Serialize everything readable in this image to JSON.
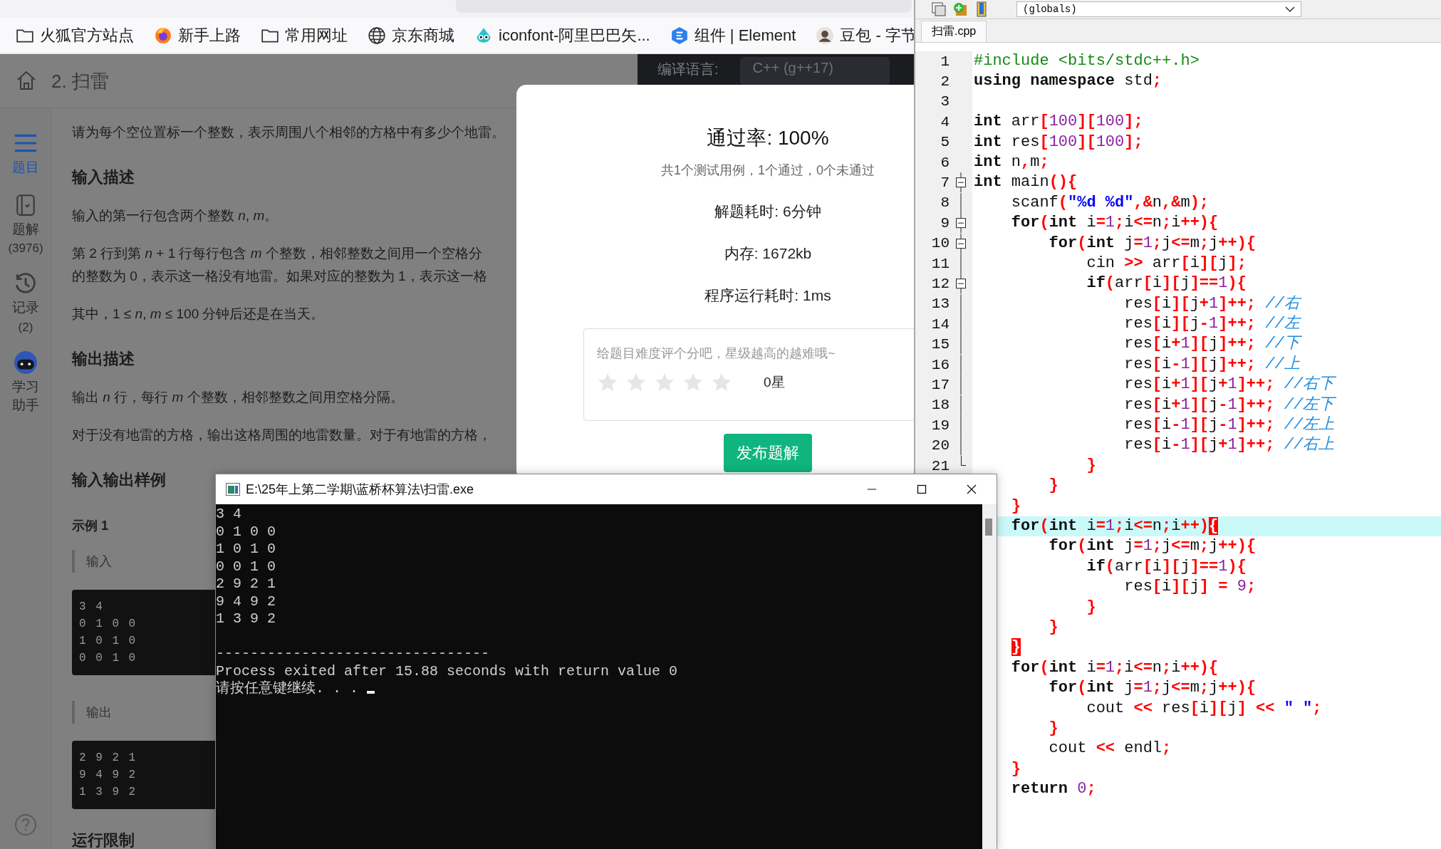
{
  "browser": {
    "bookmarks": [
      {
        "kind": "folder",
        "label": "火狐官方站点"
      },
      {
        "kind": "firefox",
        "label": "新手上路"
      },
      {
        "kind": "folder",
        "label": "常用网址"
      },
      {
        "kind": "globe",
        "label": "京东商城"
      },
      {
        "kind": "mascot",
        "label": "iconfont-阿里巴巴矢..."
      },
      {
        "kind": "hexagon",
        "label": "组件 | Element"
      },
      {
        "kind": "avatar",
        "label": "豆包 - 字节"
      }
    ],
    "page": {
      "title": "2. 扫雷",
      "compile_label": "编译语言:",
      "compile_value": "C++ (g++17)",
      "sidebar": [
        {
          "kind": "list",
          "label": "题目",
          "selected": true
        },
        {
          "kind": "book",
          "label": "题解",
          "count": "(3976)",
          "selected": false
        },
        {
          "kind": "history",
          "label": "记录",
          "count": "(2)",
          "selected": false
        },
        {
          "kind": "robot",
          "label": "学习助手",
          "selected": false
        }
      ],
      "blocks": [
        {
          "kind": "p",
          "lines": [
            "请为每个空位置标一个整数，表示周围八个相邻的方格中有多少个地雷。"
          ]
        },
        {
          "kind": "h",
          "text": "输入描述"
        },
        {
          "kind": "p",
          "lines": [
            "输入的第一行包含两个整数 *n*, *m*。"
          ]
        },
        {
          "kind": "p",
          "lines": [
            "第 2 行到第 *n* + 1 行每行包含 *m* 个整数，相邻整数之间用一个空格分",
            "的整数为 0，表示这一格没有地雷。如果对应的整数为 1，表示这一格"
          ]
        },
        {
          "kind": "p",
          "lines": [
            "其中，1 ≤ *n*, *m* ≤ 100 分钟后还是在当天。"
          ]
        },
        {
          "kind": "h",
          "text": "输出描述"
        },
        {
          "kind": "p",
          "lines": [
            "输出 *n* 行，每行 *m* 个整数，相邻整数之间用空格分隔。"
          ]
        },
        {
          "kind": "p",
          "lines": [
            "对于没有地雷的方格，输出这格周围的地雷数量。对于有地雷的方格，"
          ]
        },
        {
          "kind": "h",
          "text": "输入输出样例"
        },
        {
          "kind": "h3",
          "text": "示例 1"
        },
        {
          "kind": "label",
          "text": "输入"
        },
        {
          "kind": "sample",
          "lines": [
            "3 4",
            "0 1 0 0",
            "1 0 1 0",
            "0 0 1 0"
          ]
        },
        {
          "kind": "label",
          "text": "输出"
        },
        {
          "kind": "sample",
          "lines": [
            "2 9 2 1",
            "9 4 9 2",
            "1 3 9 2"
          ]
        },
        {
          "kind": "h",
          "text": "运行限制"
        }
      ]
    },
    "modal": {
      "pass_rate": "通过率: 100%",
      "summary": "共1个测试用例，1个通过，0个未通过",
      "stats": [
        "解题耗时: 6分钟",
        "内存: 1672kb",
        "程序运行耗时: 1ms"
      ],
      "rating": {
        "hint": "给题目难度评个分吧，星级越高的越难哦~",
        "stars": 0,
        "reading": "0星"
      },
      "button": "发布题解"
    }
  },
  "console": {
    "title": "E:\\25年上第二学期\\蓝桥杯算法\\扫雷.exe",
    "cursor": true,
    "lines": [
      {
        "kind": "out",
        "text": "3 4"
      },
      {
        "kind": "out",
        "text": "0 1 0 0"
      },
      {
        "kind": "out",
        "text": "1 0 1 0"
      },
      {
        "kind": "out",
        "text": "0 0 1 0"
      },
      {
        "kind": "out",
        "text": "2 9 2 1"
      },
      {
        "kind": "out",
        "text": "9 4 9 2"
      },
      {
        "kind": "out",
        "text": "1 3 9 2"
      },
      {
        "kind": "rule",
        "text": "--------------------------------"
      },
      {
        "kind": "out",
        "text": "Process exited after 15.88 seconds with return value 0"
      },
      {
        "kind": "prompt",
        "text": "请按任意键继续. . . "
      }
    ]
  },
  "editor": {
    "scope": "(globals)",
    "tab": "扫雷.cpp",
    "lines": [
      {
        "num": "1",
        "highlighted": false,
        "tokens": [
          {
            "kind": "pre",
            "text": "#include <bits/stdc++.h>"
          }
        ]
      },
      {
        "num": "2",
        "highlighted": false,
        "tokens": [
          {
            "kind": "kw",
            "text": "using namespace"
          },
          {
            "kind": "id",
            "text": " std"
          },
          {
            "kind": "punct",
            "text": ";"
          }
        ]
      },
      {
        "num": "3",
        "highlighted": false
      },
      {
        "num": "4",
        "highlighted": false,
        "tokens": [
          {
            "kind": "kw",
            "text": "int"
          },
          {
            "kind": "id",
            "text": " arr"
          },
          {
            "kind": "punct",
            "text": "["
          },
          {
            "kind": "num",
            "text": "100"
          },
          {
            "kind": "punct",
            "text": "]["
          },
          {
            "kind": "num",
            "text": "100"
          },
          {
            "kind": "punct",
            "text": "];"
          }
        ]
      },
      {
        "num": "5",
        "highlighted": false,
        "tokens": [
          {
            "kind": "kw",
            "text": "int"
          },
          {
            "kind": "id",
            "text": " res"
          },
          {
            "kind": "punct",
            "text": "["
          },
          {
            "kind": "num",
            "text": "100"
          },
          {
            "kind": "punct",
            "text": "]["
          },
          {
            "kind": "num",
            "text": "100"
          },
          {
            "kind": "punct",
            "text": "];"
          }
        ]
      },
      {
        "num": "6",
        "highlighted": false,
        "tokens": [
          {
            "kind": "kw",
            "text": "int"
          },
          {
            "kind": "id",
            "text": " n"
          },
          {
            "kind": "punct",
            "text": ","
          },
          {
            "kind": "id",
            "text": "m"
          },
          {
            "kind": "punct",
            "text": ";"
          }
        ]
      },
      {
        "num": "7",
        "fold": {
          "kind": "box"
        },
        "highlighted": false,
        "tokens": [
          {
            "kind": "kw",
            "text": "int"
          },
          {
            "kind": "id",
            "text": " main"
          },
          {
            "kind": "punct",
            "text": "(){"
          }
        ]
      },
      {
        "num": "8",
        "fold": {
          "kind": "line"
        },
        "highlighted": false,
        "tokens": [
          {
            "kind": "id",
            "text": "    scanf"
          },
          {
            "kind": "punct",
            "text": "("
          },
          {
            "kind": "str",
            "text": "\"%d %d\""
          },
          {
            "kind": "punct",
            "text": ",&"
          },
          {
            "kind": "id",
            "text": "n"
          },
          {
            "kind": "punct",
            "text": ",&"
          },
          {
            "kind": "id",
            "text": "m"
          },
          {
            "kind": "punct",
            "text": ");"
          }
        ]
      },
      {
        "num": "9",
        "fold": {
          "kind": "box"
        },
        "highlighted": false,
        "tokens": [
          {
            "kind": "kw",
            "text": "    for"
          },
          {
            "kind": "punct",
            "text": "("
          },
          {
            "kind": "kw",
            "text": "int"
          },
          {
            "kind": "id",
            "text": " i"
          },
          {
            "kind": "punct",
            "text": "="
          },
          {
            "kind": "num",
            "text": "1"
          },
          {
            "kind": "punct",
            "text": ";"
          },
          {
            "kind": "id",
            "text": "i"
          },
          {
            "kind": "punct",
            "text": "<="
          },
          {
            "kind": "id",
            "text": "n"
          },
          {
            "kind": "punct",
            "text": ";"
          },
          {
            "kind": "id",
            "text": "i"
          },
          {
            "kind": "punct",
            "text": "++){"
          }
        ]
      },
      {
        "num": "10",
        "fold": {
          "kind": "box"
        },
        "highlighted": false,
        "tokens": [
          {
            "kind": "kw",
            "text": "        for"
          },
          {
            "kind": "punct",
            "text": "("
          },
          {
            "kind": "kw",
            "text": "int"
          },
          {
            "kind": "id",
            "text": " j"
          },
          {
            "kind": "punct",
            "text": "="
          },
          {
            "kind": "num",
            "text": "1"
          },
          {
            "kind": "punct",
            "text": ";"
          },
          {
            "kind": "id",
            "text": "j"
          },
          {
            "kind": "punct",
            "text": "<="
          },
          {
            "kind": "id",
            "text": "m"
          },
          {
            "kind": "punct",
            "text": ";"
          },
          {
            "kind": "id",
            "text": "j"
          },
          {
            "kind": "punct",
            "text": "++){"
          }
        ]
      },
      {
        "num": "11",
        "fold": {
          "kind": "line"
        },
        "highlighted": false,
        "tokens": [
          {
            "kind": "id",
            "text": "            cin "
          },
          {
            "kind": "punct",
            "text": ">>"
          },
          {
            "kind": "id",
            "text": " arr"
          },
          {
            "kind": "punct",
            "text": "["
          },
          {
            "kind": "id",
            "text": "i"
          },
          {
            "kind": "punct",
            "text": "]["
          },
          {
            "kind": "id",
            "text": "j"
          },
          {
            "kind": "punct",
            "text": "];"
          }
        ]
      },
      {
        "num": "12",
        "fold": {
          "kind": "box"
        },
        "highlighted": false,
        "tokens": [
          {
            "kind": "kw",
            "text": "            if"
          },
          {
            "kind": "punct",
            "text": "("
          },
          {
            "kind": "id",
            "text": "arr"
          },
          {
            "kind": "punct",
            "text": "["
          },
          {
            "kind": "id",
            "text": "i"
          },
          {
            "kind": "punct",
            "text": "]["
          },
          {
            "kind": "id",
            "text": "j"
          },
          {
            "kind": "punct",
            "text": "]=="
          },
          {
            "kind": "num",
            "text": "1"
          },
          {
            "kind": "punct",
            "text": "){"
          }
        ]
      },
      {
        "num": "13",
        "fold": {
          "kind": "line"
        },
        "highlighted": false,
        "tokens": [
          {
            "kind": "id",
            "text": "                res"
          },
          {
            "kind": "punct",
            "text": "["
          },
          {
            "kind": "id",
            "text": "i"
          },
          {
            "kind": "punct",
            "text": "]["
          },
          {
            "kind": "id",
            "text": "j"
          },
          {
            "kind": "punct",
            "text": "+"
          },
          {
            "kind": "num",
            "text": "1"
          },
          {
            "kind": "punct",
            "text": "]++;"
          },
          {
            "kind": "comment",
            "text": " //右"
          }
        ]
      },
      {
        "num": "14",
        "fold": {
          "kind": "line"
        },
        "highlighted": false,
        "tokens": [
          {
            "kind": "id",
            "text": "                res"
          },
          {
            "kind": "punct",
            "text": "["
          },
          {
            "kind": "id",
            "text": "i"
          },
          {
            "kind": "punct",
            "text": "]["
          },
          {
            "kind": "id",
            "text": "j"
          },
          {
            "kind": "punct",
            "text": "-"
          },
          {
            "kind": "num",
            "text": "1"
          },
          {
            "kind": "punct",
            "text": "]++;"
          },
          {
            "kind": "comment",
            "text": " //左"
          }
        ]
      },
      {
        "num": "15",
        "fold": {
          "kind": "line"
        },
        "highlighted": false,
        "tokens": [
          {
            "kind": "id",
            "text": "                res"
          },
          {
            "kind": "punct",
            "text": "["
          },
          {
            "kind": "id",
            "text": "i"
          },
          {
            "kind": "punct",
            "text": "+"
          },
          {
            "kind": "num",
            "text": "1"
          },
          {
            "kind": "punct",
            "text": "]["
          },
          {
            "kind": "id",
            "text": "j"
          },
          {
            "kind": "punct",
            "text": "]++;"
          },
          {
            "kind": "comment",
            "text": " //下"
          }
        ]
      },
      {
        "num": "16",
        "fold": {
          "kind": "line"
        },
        "highlighted": false,
        "tokens": [
          {
            "kind": "id",
            "text": "                res"
          },
          {
            "kind": "punct",
            "text": "["
          },
          {
            "kind": "id",
            "text": "i"
          },
          {
            "kind": "punct",
            "text": "-"
          },
          {
            "kind": "num",
            "text": "1"
          },
          {
            "kind": "punct",
            "text": "]["
          },
          {
            "kind": "id",
            "text": "j"
          },
          {
            "kind": "punct",
            "text": "]++;"
          },
          {
            "kind": "comment",
            "text": " //上"
          }
        ]
      },
      {
        "num": "17",
        "fold": {
          "kind": "line"
        },
        "highlighted": false,
        "tokens": [
          {
            "kind": "id",
            "text": "                res"
          },
          {
            "kind": "punct",
            "text": "["
          },
          {
            "kind": "id",
            "text": "i"
          },
          {
            "kind": "punct",
            "text": "+"
          },
          {
            "kind": "num",
            "text": "1"
          },
          {
            "kind": "punct",
            "text": "]["
          },
          {
            "kind": "id",
            "text": "j"
          },
          {
            "kind": "punct",
            "text": "+"
          },
          {
            "kind": "num",
            "text": "1"
          },
          {
            "kind": "punct",
            "text": "]++;"
          },
          {
            "kind": "comment",
            "text": " //右下"
          }
        ]
      },
      {
        "num": "18",
        "fold": {
          "kind": "line"
        },
        "highlighted": false,
        "tokens": [
          {
            "kind": "id",
            "text": "                res"
          },
          {
            "kind": "punct",
            "text": "["
          },
          {
            "kind": "id",
            "text": "i"
          },
          {
            "kind": "punct",
            "text": "+"
          },
          {
            "kind": "num",
            "text": "1"
          },
          {
            "kind": "punct",
            "text": "]["
          },
          {
            "kind": "id",
            "text": "j"
          },
          {
            "kind": "punct",
            "text": "-"
          },
          {
            "kind": "num",
            "text": "1"
          },
          {
            "kind": "punct",
            "text": "]++;"
          },
          {
            "kind": "comment",
            "text": " //左下"
          }
        ]
      },
      {
        "num": "19",
        "fold": {
          "kind": "line"
        },
        "highlighted": false,
        "tokens": [
          {
            "kind": "id",
            "text": "                res"
          },
          {
            "kind": "punct",
            "text": "["
          },
          {
            "kind": "id",
            "text": "i"
          },
          {
            "kind": "punct",
            "text": "-"
          },
          {
            "kind": "num",
            "text": "1"
          },
          {
            "kind": "punct",
            "text": "]["
          },
          {
            "kind": "id",
            "text": "j"
          },
          {
            "kind": "punct",
            "text": "-"
          },
          {
            "kind": "num",
            "text": "1"
          },
          {
            "kind": "punct",
            "text": "]++;"
          },
          {
            "kind": "comment",
            "text": " //左上"
          }
        ]
      },
      {
        "num": "20",
        "fold": {
          "kind": "line"
        },
        "highlighted": false,
        "tokens": [
          {
            "kind": "id",
            "text": "                res"
          },
          {
            "kind": "punct",
            "text": "["
          },
          {
            "kind": "id",
            "text": "i"
          },
          {
            "kind": "punct",
            "text": "-"
          },
          {
            "kind": "num",
            "text": "1"
          },
          {
            "kind": "punct",
            "text": "]["
          },
          {
            "kind": "id",
            "text": "j"
          },
          {
            "kind": "punct",
            "text": "+"
          },
          {
            "kind": "num",
            "text": "1"
          },
          {
            "kind": "punct",
            "text": "]++;"
          },
          {
            "kind": "comment",
            "text": " //右上"
          }
        ]
      },
      {
        "num": "21",
        "fold": {
          "kind": "end"
        },
        "highlighted": false,
        "tokens": [
          {
            "kind": "punct",
            "text": "            }"
          }
        ]
      },
      {
        "highlighted": false,
        "tokens": [
          {
            "kind": "punct",
            "text": "        }"
          }
        ]
      },
      {
        "highlighted": false,
        "tokens": [
          {
            "kind": "punct",
            "text": "    }"
          }
        ]
      },
      {
        "highlighted": true,
        "tokens": [
          {
            "kind": "kw",
            "text": "    for"
          },
          {
            "kind": "punct",
            "text": "("
          },
          {
            "kind": "kw",
            "text": "int"
          },
          {
            "kind": "id",
            "text": " i"
          },
          {
            "kind": "punct",
            "text": "="
          },
          {
            "kind": "num",
            "text": "1"
          },
          {
            "kind": "punct",
            "text": ";"
          },
          {
            "kind": "id",
            "text": "i"
          },
          {
            "kind": "punct",
            "text": "<="
          },
          {
            "kind": "id",
            "text": "n"
          },
          {
            "kind": "punct",
            "text": ";"
          },
          {
            "kind": "id",
            "text": "i"
          },
          {
            "kind": "punct",
            "text": "++)"
          },
          {
            "kind": "match",
            "text": "{"
          }
        ]
      },
      {
        "highlighted": false,
        "tokens": [
          {
            "kind": "kw",
            "text": "        for"
          },
          {
            "kind": "punct",
            "text": "("
          },
          {
            "kind": "kw",
            "text": "int"
          },
          {
            "kind": "id",
            "text": " j"
          },
          {
            "kind": "punct",
            "text": "="
          },
          {
            "kind": "num",
            "text": "1"
          },
          {
            "kind": "punct",
            "text": ";"
          },
          {
            "kind": "id",
            "text": "j"
          },
          {
            "kind": "punct",
            "text": "<="
          },
          {
            "kind": "id",
            "text": "m"
          },
          {
            "kind": "punct",
            "text": ";"
          },
          {
            "kind": "id",
            "text": "j"
          },
          {
            "kind": "punct",
            "text": "++){"
          }
        ]
      },
      {
        "highlighted": false,
        "tokens": [
          {
            "kind": "kw",
            "text": "            if"
          },
          {
            "kind": "punct",
            "text": "("
          },
          {
            "kind": "id",
            "text": "arr"
          },
          {
            "kind": "punct",
            "text": "["
          },
          {
            "kind": "id",
            "text": "i"
          },
          {
            "kind": "punct",
            "text": "]["
          },
          {
            "kind": "id",
            "text": "j"
          },
          {
            "kind": "punct",
            "text": "]=="
          },
          {
            "kind": "num",
            "text": "1"
          },
          {
            "kind": "punct",
            "text": "){"
          }
        ]
      },
      {
        "highlighted": false,
        "tokens": [
          {
            "kind": "id",
            "text": "                res"
          },
          {
            "kind": "punct",
            "text": "["
          },
          {
            "kind": "id",
            "text": "i"
          },
          {
            "kind": "punct",
            "text": "]["
          },
          {
            "kind": "id",
            "text": "j"
          },
          {
            "kind": "punct",
            "text": "] = "
          },
          {
            "kind": "num",
            "text": "9"
          },
          {
            "kind": "punct",
            "text": ";"
          }
        ]
      },
      {
        "highlighted": false,
        "tokens": [
          {
            "kind": "punct",
            "text": "            }"
          }
        ]
      },
      {
        "highlighted": false,
        "tokens": [
          {
            "kind": "punct",
            "text": "        }"
          }
        ]
      },
      {
        "highlighted": false,
        "tokens": [
          {
            "kind": "match",
            "text": "    }"
          }
        ]
      },
      {
        "highlighted": false,
        "tokens": [
          {
            "kind": "kw",
            "text": "    for"
          },
          {
            "kind": "punct",
            "text": "("
          },
          {
            "kind": "kw",
            "text": "int"
          },
          {
            "kind": "id",
            "text": " i"
          },
          {
            "kind": "punct",
            "text": "="
          },
          {
            "kind": "num",
            "text": "1"
          },
          {
            "kind": "punct",
            "text": ";"
          },
          {
            "kind": "id",
            "text": "i"
          },
          {
            "kind": "punct",
            "text": "<="
          },
          {
            "kind": "id",
            "text": "n"
          },
          {
            "kind": "punct",
            "text": ";"
          },
          {
            "kind": "id",
            "text": "i"
          },
          {
            "kind": "punct",
            "text": "++){"
          }
        ]
      },
      {
        "highlighted": false,
        "tokens": [
          {
            "kind": "kw",
            "text": "        for"
          },
          {
            "kind": "punct",
            "text": "("
          },
          {
            "kind": "kw",
            "text": "int"
          },
          {
            "kind": "id",
            "text": " j"
          },
          {
            "kind": "punct",
            "text": "="
          },
          {
            "kind": "num",
            "text": "1"
          },
          {
            "kind": "punct",
            "text": ";"
          },
          {
            "kind": "id",
            "text": "j"
          },
          {
            "kind": "punct",
            "text": "<="
          },
          {
            "kind": "id",
            "text": "m"
          },
          {
            "kind": "punct",
            "text": ";"
          },
          {
            "kind": "id",
            "text": "j"
          },
          {
            "kind": "punct",
            "text": "++){"
          }
        ]
      },
      {
        "highlighted": false,
        "tokens": [
          {
            "kind": "id",
            "text": "            cout "
          },
          {
            "kind": "punct",
            "text": "<<"
          },
          {
            "kind": "id",
            "text": " res"
          },
          {
            "kind": "punct",
            "text": "["
          },
          {
            "kind": "id",
            "text": "i"
          },
          {
            "kind": "punct",
            "text": "]["
          },
          {
            "kind": "id",
            "text": "j"
          },
          {
            "kind": "punct",
            "text": "] <<"
          },
          {
            "kind": "str",
            "text": " \" \""
          },
          {
            "kind": "punct",
            "text": ";"
          }
        ]
      },
      {
        "highlighted": false,
        "tokens": [
          {
            "kind": "punct",
            "text": "        }"
          }
        ]
      },
      {
        "highlighted": false,
        "tokens": [
          {
            "kind": "id",
            "text": "        cout "
          },
          {
            "kind": "punct",
            "text": "<<"
          },
          {
            "kind": "id",
            "text": " endl"
          },
          {
            "kind": "punct",
            "text": ";"
          }
        ]
      },
      {
        "highlighted": false,
        "tokens": [
          {
            "kind": "punct",
            "text": "    }"
          }
        ]
      },
      {
        "highlighted": false,
        "tokens": [
          {
            "kind": "kw",
            "text": "    return"
          },
          {
            "kind": "num",
            "text": " 0"
          },
          {
            "kind": "punct",
            "text": ";"
          }
        ]
      }
    ]
  }
}
